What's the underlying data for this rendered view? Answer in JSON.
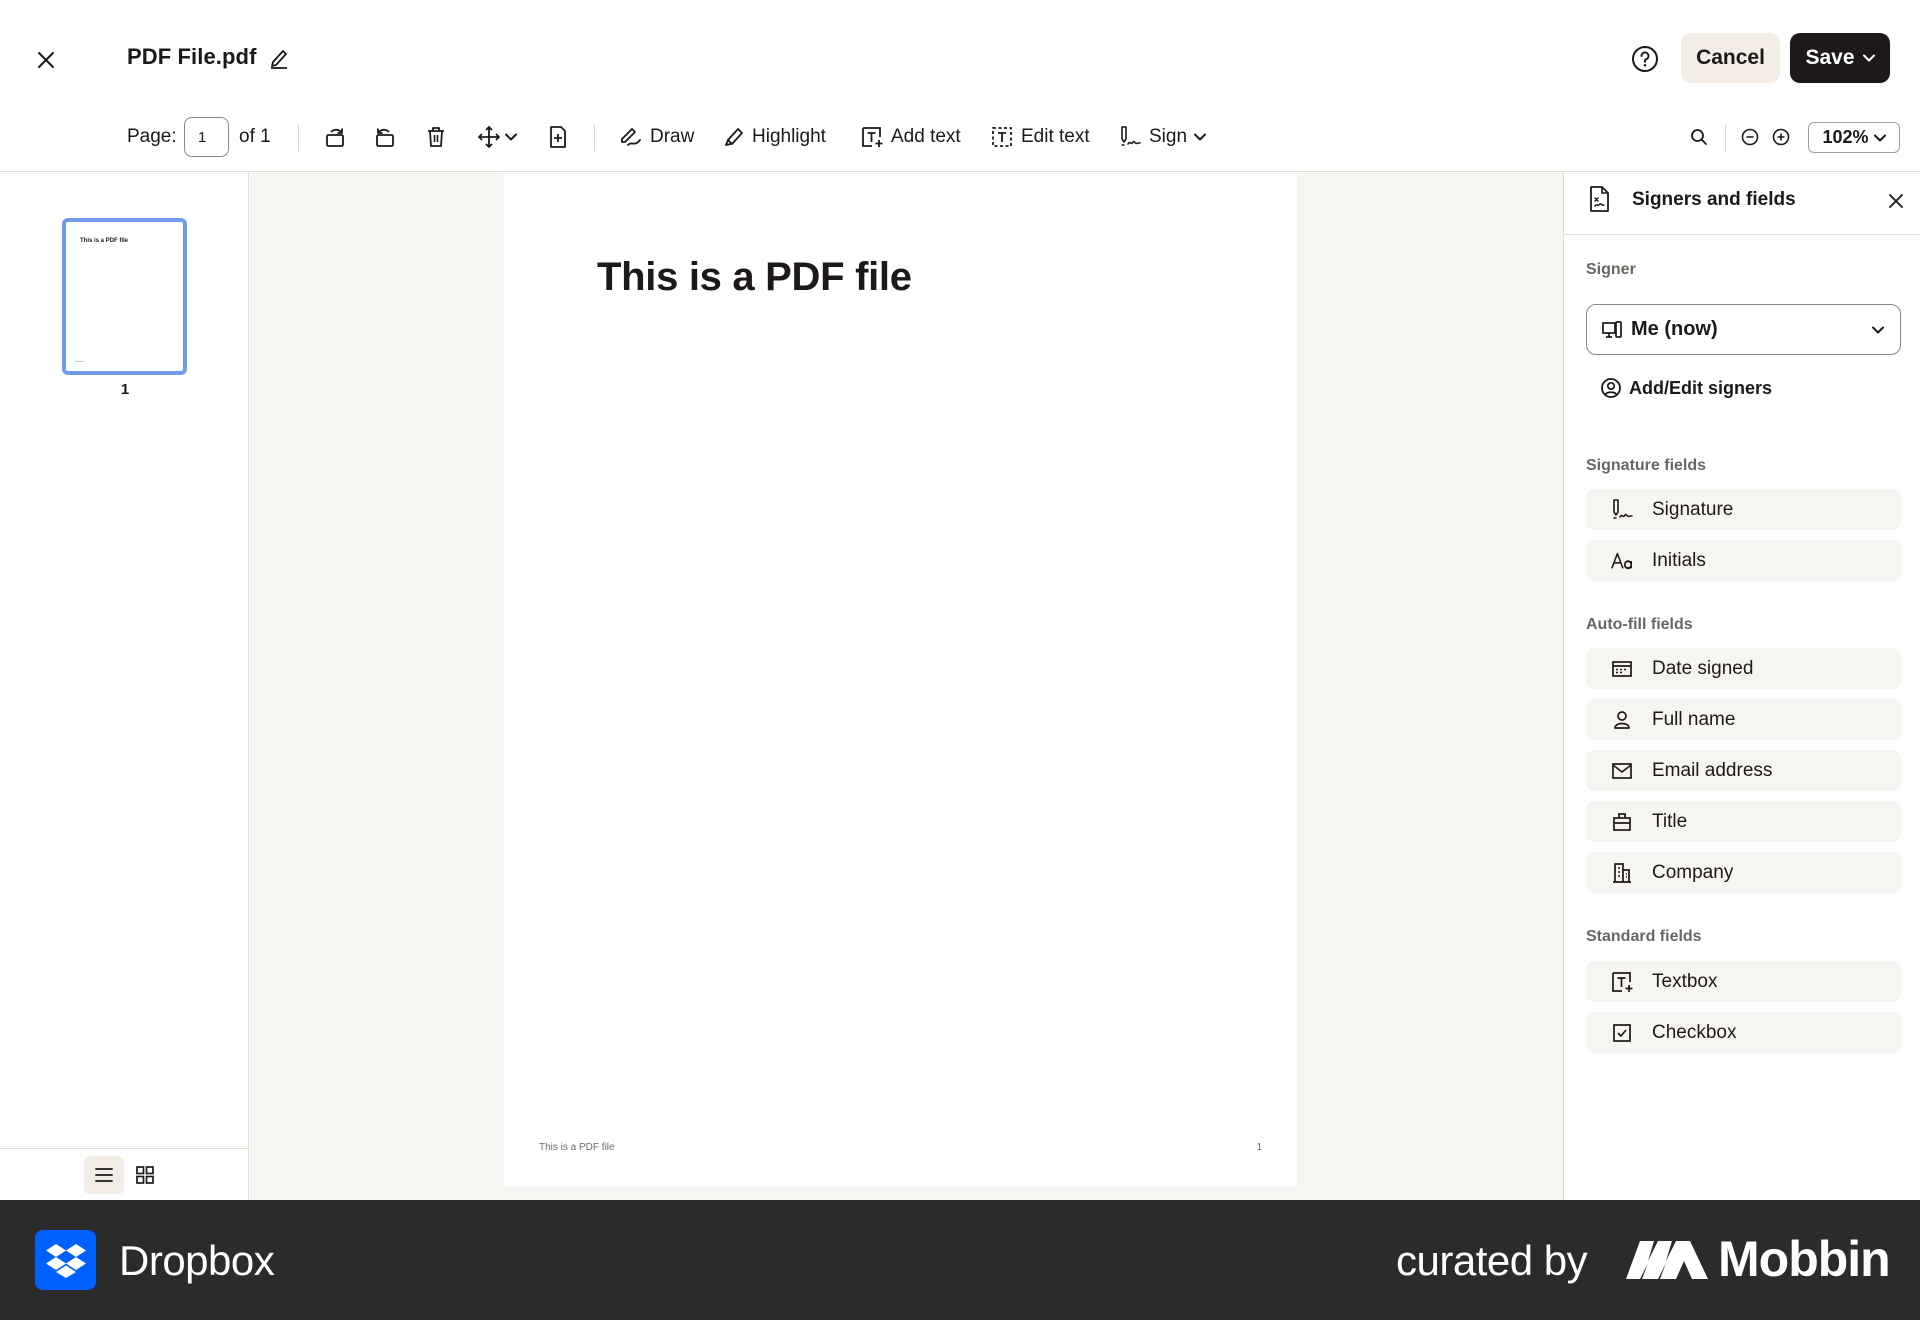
{
  "header": {
    "file_name": "PDF File.pdf",
    "cancel_label": "Cancel",
    "save_label": "Save"
  },
  "toolbar": {
    "page_label": "Page:",
    "page_value": "1",
    "page_of": "of 1",
    "draw_label": "Draw",
    "highlight_label": "Highlight",
    "add_text_label": "Add text",
    "edit_text_label": "Edit text",
    "sign_label": "Sign",
    "zoom_value": "102%"
  },
  "thumbnails": {
    "items": [
      {
        "title": "This is a PDF file",
        "number": "1"
      }
    ]
  },
  "document": {
    "heading": "This is a PDF file",
    "footer_text": "This is a PDF file",
    "footer_page": "1"
  },
  "panel": {
    "title": "Signers and fields",
    "signer_label": "Signer",
    "signer_value": "Me (now)",
    "add_signers_label": "Add/Edit signers",
    "signature_fields_label": "Signature fields",
    "signature_fields": [
      "Signature",
      "Initials"
    ],
    "autofill_fields_label": "Auto-fill fields",
    "autofill_fields": [
      "Date signed",
      "Full name",
      "Email address",
      "Title",
      "Company"
    ],
    "standard_fields_label": "Standard fields",
    "standard_fields": [
      "Textbox",
      "Checkbox"
    ]
  },
  "brand": {
    "app_name": "Dropbox",
    "curated_label": "curated by",
    "curator_name": "Mobbin",
    "dropbox_color": "#0061fe",
    "bar_color": "#2b2b2b"
  },
  "icons": {
    "close": "close-icon",
    "rename": "pencil-icon",
    "help": "question-circle-icon",
    "rotate_left": "rotate-left-icon",
    "rotate_right": "rotate-right-icon",
    "delete": "trash-icon",
    "move": "move-icon",
    "insert_page": "add-page-icon",
    "search": "search-icon",
    "zoom_out": "zoom-out-icon",
    "zoom_in": "zoom-in-icon",
    "list_view": "list-view-icon",
    "grid_view": "grid-view-icon"
  }
}
